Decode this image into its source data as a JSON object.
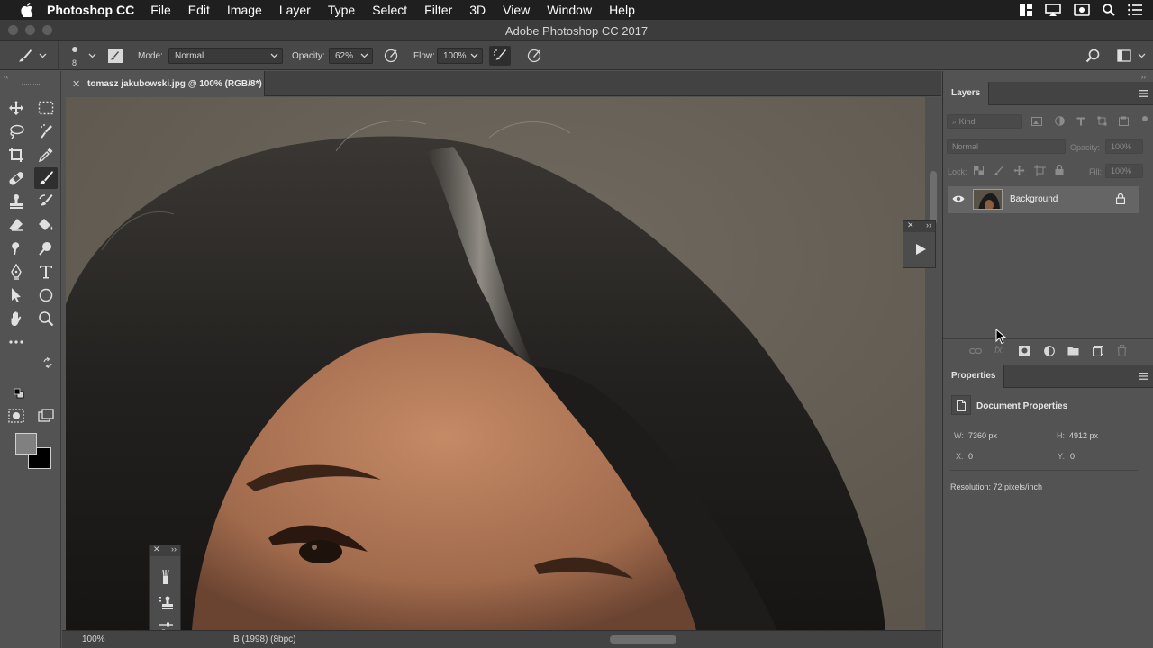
{
  "menubar": {
    "app_name": "Photoshop CC",
    "menus": [
      "File",
      "Edit",
      "Image",
      "Layer",
      "Type",
      "Select",
      "Filter",
      "3D",
      "View",
      "Window",
      "Help"
    ]
  },
  "window": {
    "title": "Adobe Photoshop CC 2017"
  },
  "options": {
    "brush_size": "8",
    "mode_label": "Mode:",
    "mode_value": "Normal",
    "opacity_label": "Opacity:",
    "opacity_value": "62%",
    "flow_label": "Flow:",
    "flow_value": "100%"
  },
  "document": {
    "tab_title": "tomasz jakubowski.jpg @ 100% (RGB/8*)",
    "zoom": "100%",
    "status_info": "B (1998) (8bpc)"
  },
  "layers_panel": {
    "tab": "Layers",
    "kind_placeholder": "Kind",
    "blend_mode": "Normal",
    "opacity_label": "Opacity:",
    "opacity_value": "100%",
    "lock_label": "Lock:",
    "fill_label": "Fill:",
    "fill_value": "100%",
    "layers": [
      {
        "name": "Background",
        "locked": true,
        "visible": true
      }
    ]
  },
  "properties_panel": {
    "tab": "Properties",
    "section_title": "Document Properties",
    "w_label": "W:",
    "w_value": "7360 px",
    "h_label": "H:",
    "h_value": "4912 px",
    "x_label": "X:",
    "x_value": "0",
    "y_label": "Y:",
    "y_value": "0",
    "resolution": "Resolution: 72 pixels/inch"
  },
  "colors": {
    "foreground": "#808080",
    "background": "#000000",
    "ui_dark": "#535353"
  }
}
